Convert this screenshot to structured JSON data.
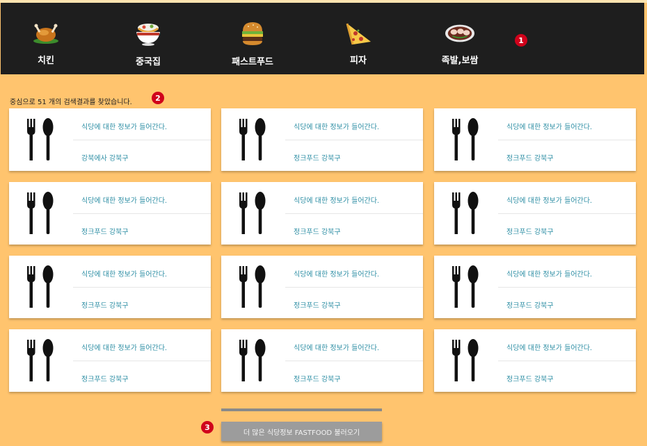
{
  "nav": {
    "items": [
      {
        "label": "치킨",
        "icon": "chicken-icon"
      },
      {
        "label": "중국집",
        "icon": "noodle-bowl-icon"
      },
      {
        "label": "패스트푸드",
        "icon": "burger-icon"
      },
      {
        "label": "피자",
        "icon": "pizza-icon"
      },
      {
        "label": "족발,보쌈",
        "icon": "pork-platter-icon"
      }
    ],
    "background": "#1e1e1e"
  },
  "markers": [
    "1",
    "2",
    "3"
  ],
  "results": {
    "summary": "중심으로 51 개의 검색결과를 찾았습니다."
  },
  "cards": [
    {
      "info": "식당에 대한 정보가 들어간다.",
      "location": "강북에사 강북구"
    },
    {
      "info": "식당에 대한 정보가 들어간다.",
      "location": "정크푸드 강북구"
    },
    {
      "info": "식당에 대한 정보가 들어간다.",
      "location": "정크푸드 강북구"
    },
    {
      "info": "식당에 대한 정보가 들어간다.",
      "location": "정크푸드 강북구"
    },
    {
      "info": "식당에 대한 정보가 들어간다.",
      "location": "정크푸드 강북구"
    },
    {
      "info": "식당에 대한 정보가 들어간다.",
      "location": "정크푸드 강북구"
    },
    {
      "info": "식당에 대한 정보가 들어간다.",
      "location": "정크푸드 강북구"
    },
    {
      "info": "식당에 대한 정보가 들어간다.",
      "location": "정크푸드 강북구"
    },
    {
      "info": "식당에 대한 정보가 들어간다.",
      "location": "정크푸드 강북구"
    },
    {
      "info": "식당에 대한 정보가 들어간다.",
      "location": "정크푸드 강북구"
    },
    {
      "info": "식당에 대한 정보가 들어간다.",
      "location": "정크푸드 강북구"
    },
    {
      "info": "식당에 대한 정보가 들어간다.",
      "location": "정크푸드 강북구"
    }
  ],
  "load_more": {
    "label": "더 많은 식당정보 FASTFOOD 불러오기"
  },
  "colors": {
    "page_background": "#ffc46e",
    "card_text": "#2f8fa5",
    "marker": "#d0021b"
  }
}
